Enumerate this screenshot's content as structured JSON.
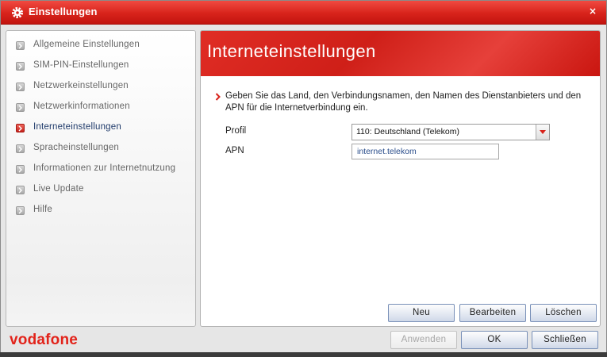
{
  "window": {
    "title": "Einstellungen",
    "close_glyph": "×",
    "icon": "gear-icon"
  },
  "sidebar": {
    "items": [
      {
        "label": "Allgemeine Einstellungen",
        "active": false
      },
      {
        "label": "SIM-PIN-Einstellungen",
        "active": false
      },
      {
        "label": "Netzwerkeinstellungen",
        "active": false
      },
      {
        "label": "Netzwerkinformationen",
        "active": false
      },
      {
        "label": "Interneteinstellungen",
        "active": true
      },
      {
        "label": "Spracheinstellungen",
        "active": false
      },
      {
        "label": "Informationen zur Internetnutzung",
        "active": false
      },
      {
        "label": "Live Update",
        "active": false
      },
      {
        "label": "Hilfe",
        "active": false
      }
    ]
  },
  "main": {
    "title": "Interneteinstellungen",
    "description": "Geben Sie das Land, den Verbindungsnamen, den Namen des Dienstanbieters und den APN für die Internetverbindung ein.",
    "profile_label": "Profil",
    "profile_value": "110: Deutschland (Telekom)",
    "apn_label": "APN",
    "apn_value": "internet.telekom",
    "buttons": {
      "new": "Neu",
      "edit": "Bearbeiten",
      "delete": "Löschen"
    }
  },
  "footer": {
    "brand": "vodafone",
    "apply": "Anwenden",
    "apply_enabled": false,
    "ok": "OK",
    "close": "Schließen"
  },
  "colors": {
    "accent_red": "#e2231a",
    "active_text": "#1f3a6a",
    "inactive_text": "#666666"
  }
}
